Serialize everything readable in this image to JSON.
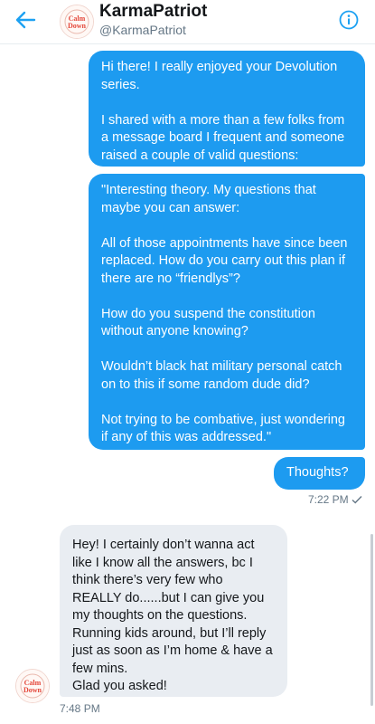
{
  "header": {
    "name": "KarmaPatriot",
    "handle": "@KarmaPatriot",
    "avatar_text": "Calm Down"
  },
  "icons": {
    "back": "back-arrow-icon",
    "info": "info-icon",
    "sent": "sent-check-icon"
  },
  "messages": [
    {
      "direction": "outgoing",
      "text": "Hi there! I really enjoyed your Devolution series.\n\nI shared with a more than a few folks from a message board I frequent and someone raised a couple of valid questions:"
    },
    {
      "direction": "outgoing",
      "text": "\"Interesting theory. My questions that maybe you can answer:\n\nAll of those appointments have since been replaced. How do you carry out this plan if there are no “friendlys”?\n\nHow do you suspend the constitution without anyone knowing?\n\nWouldn’t black hat military personal catch on to this if some random dude did?\n\nNot trying to be combative, just wondering if any of this was addressed.\""
    },
    {
      "direction": "outgoing",
      "text": "Thoughts?",
      "time": "7:22 PM"
    },
    {
      "direction": "incoming",
      "text": "Hey! I certainly don’t wanna act like I know all the answers, bc I think there’s very few who REALLY do......but I can give you my thoughts on the questions. Running kids around, but I’ll reply just as soon as I’m home & have a few mins.\nGlad you asked!",
      "time": "7:48 PM"
    }
  ],
  "colors": {
    "accent": "#1da1f2",
    "outgoing_bubble": "#1d9bf0",
    "incoming_bubble": "#e9edf2"
  }
}
